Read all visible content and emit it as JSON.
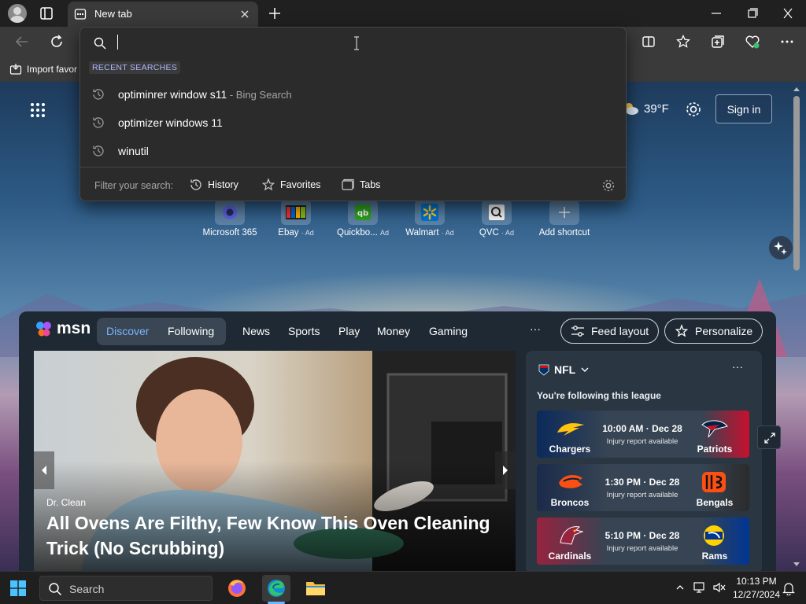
{
  "browser": {
    "tab_title": "New tab",
    "favorites_bar": {
      "import_label": "Import favor"
    }
  },
  "search_dropdown": {
    "input_value": "",
    "section_label": "RECENT SEARCHES",
    "recent": [
      {
        "text": "optiminrer window s11",
        "suffix": " - Bing Search"
      },
      {
        "text": "optimizer windows 11",
        "suffix": ""
      },
      {
        "text": "winutil",
        "suffix": ""
      }
    ],
    "filter_label": "Filter your search:",
    "filters": [
      "History",
      "Favorites",
      "Tabs"
    ]
  },
  "newtab": {
    "weather": "39°F",
    "sign_in_label": "Sign in",
    "shortcuts": [
      {
        "label": "Microsoft 365",
        "ad": ""
      },
      {
        "label": "Ebay",
        "ad": "· Ad"
      },
      {
        "label": "Quickbo...",
        "ad": "Ad"
      },
      {
        "label": "Walmart",
        "ad": "· Ad"
      },
      {
        "label": "QVC",
        "ad": "· Ad"
      },
      {
        "label": "Add shortcut",
        "ad": ""
      }
    ]
  },
  "msn": {
    "logo_text": "msn",
    "segment": {
      "discover": "Discover",
      "following": "Following"
    },
    "nav": [
      "News",
      "Sports",
      "Play",
      "Money",
      "Gaming"
    ],
    "more": "···",
    "feed_layout_label": "Feed layout",
    "personalize_label": "Personalize",
    "hero": {
      "source": "Dr. Clean",
      "headline": "All Ovens Are Filthy, Few Know This Oven Cleaning Trick (No Scrubbing)"
    },
    "nfl": {
      "title": "NFL",
      "subtitle": "You're following this league",
      "more": "···",
      "games": [
        {
          "home": "Chargers",
          "away": "Patriots",
          "time": "10:00 AM · Dec 28",
          "status": "Injury report available",
          "home_color": "#0b2a5b",
          "away_color": "#c8102e"
        },
        {
          "home": "Broncos",
          "away": "Bengals",
          "time": "1:30 PM · Dec 28",
          "status": "Injury report available",
          "home_color": "#1b2a4a",
          "away_color": "#fb4f14"
        },
        {
          "home": "Cardinals",
          "away": "Rams",
          "time": "5:10 PM · Dec 28",
          "status": "Injury report available",
          "home_color": "#97233f",
          "away_color": "#003594"
        }
      ]
    }
  },
  "taskbar": {
    "search_placeholder": "Search",
    "time": "10:13 PM",
    "date": "12/27/2024"
  },
  "colors": {
    "accent_blue": "#7ab4ff",
    "edge_indicator": "#6cb6ff",
    "recent_label": "#aeb8ff"
  }
}
